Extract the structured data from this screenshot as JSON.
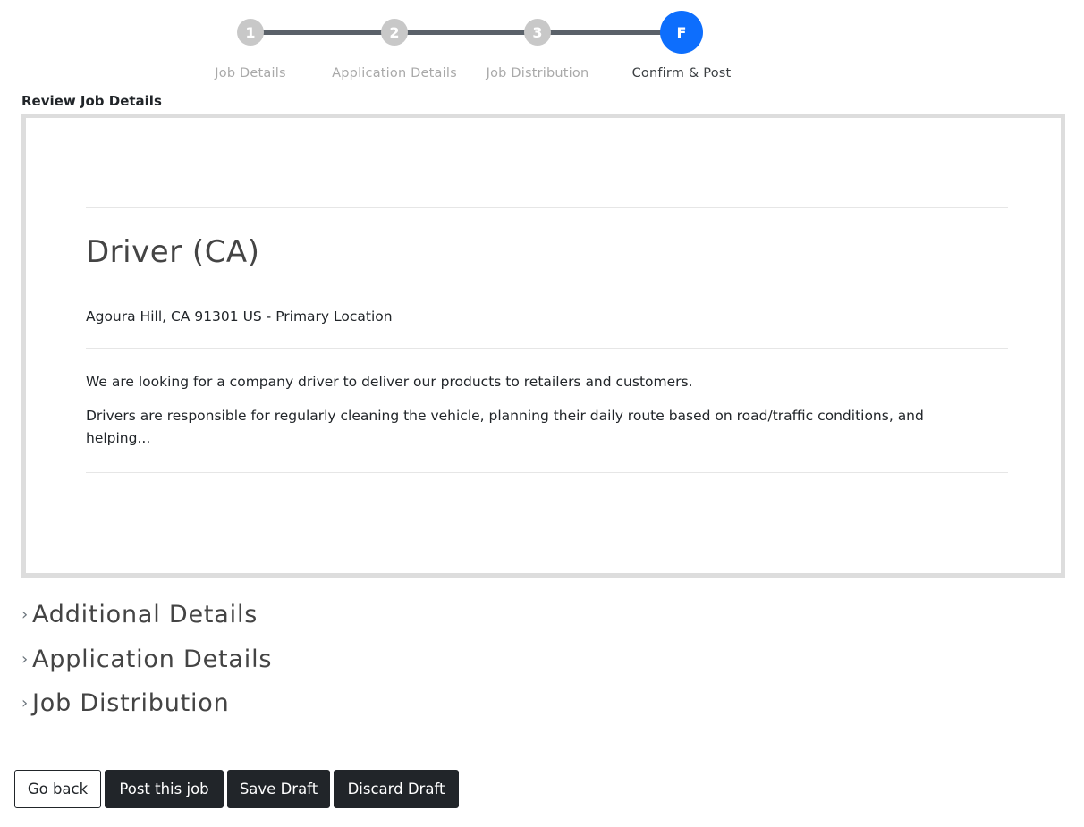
{
  "stepper": {
    "steps": [
      {
        "number": "1",
        "label": "Job Details"
      },
      {
        "number": "2",
        "label": "Application Details"
      },
      {
        "number": "3",
        "label": "Job Distribution"
      },
      {
        "number": "F",
        "label": "Confirm & Post"
      }
    ],
    "active_color": "#0d6efd",
    "inactive_color": "#c8c8c8"
  },
  "review": {
    "title": "Review Job Details",
    "job_title": "Driver (CA)",
    "location": "Agoura Hill, CA 91301 US - Primary Location",
    "description": [
      "We are looking for a company driver to deliver our products to retailers and customers.",
      "Drivers are responsible for regularly cleaning the vehicle, planning their daily route based on road/traffic conditions, and helping..."
    ]
  },
  "sections": {
    "chevron": "›",
    "items": [
      "Additional Details",
      "Application Details",
      "Job Distribution"
    ]
  },
  "actions": {
    "go_back": "Go back",
    "post": "Post this job",
    "save_draft": "Save Draft",
    "discard_draft": "Discard Draft"
  }
}
